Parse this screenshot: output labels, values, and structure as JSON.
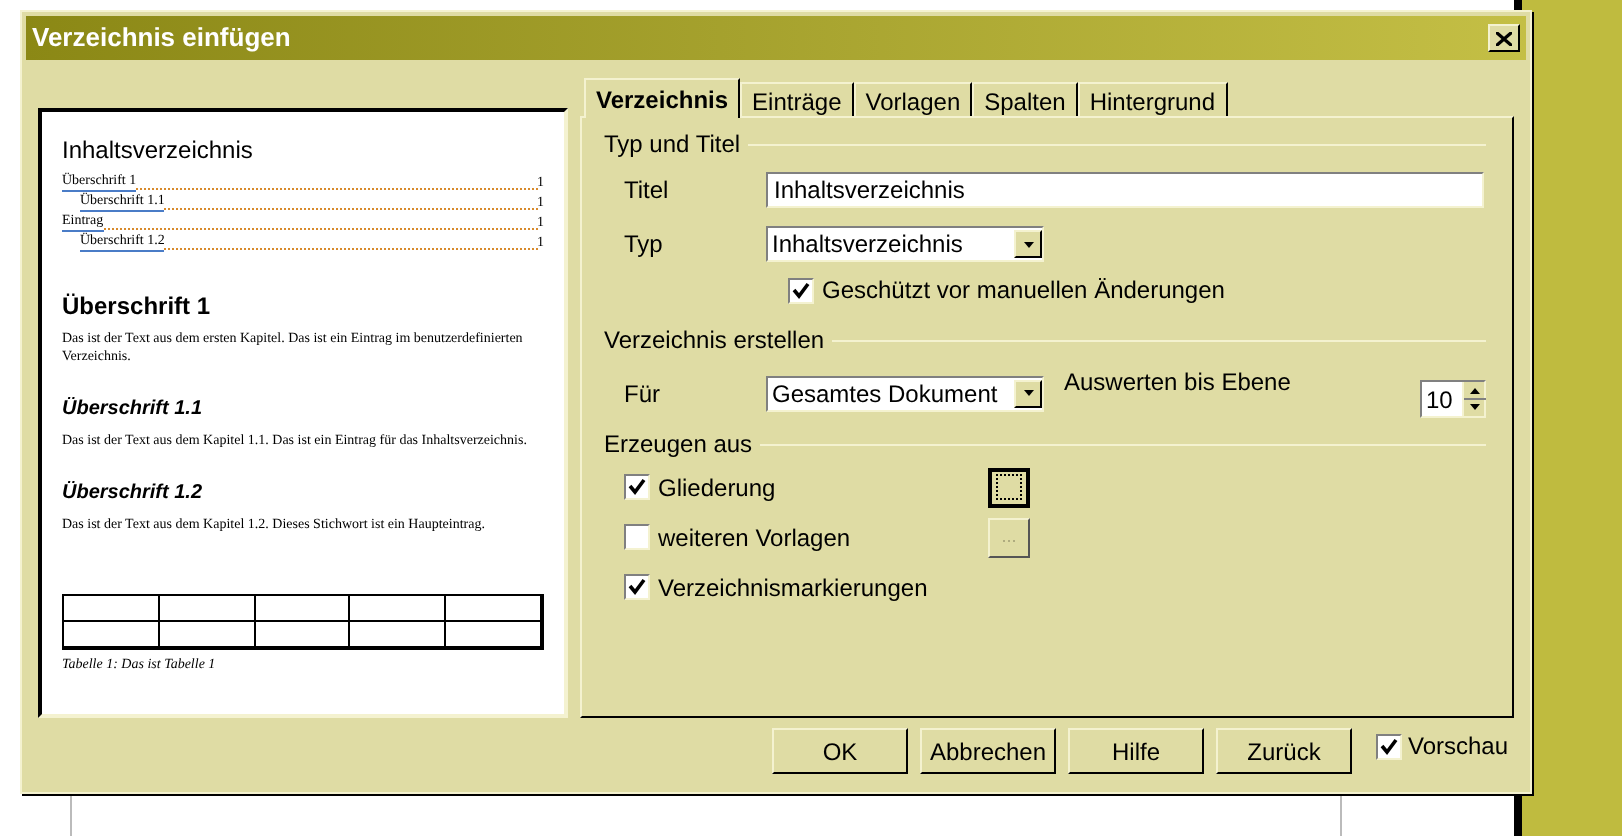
{
  "window": {
    "title": "Verzeichnis einfügen"
  },
  "preview": {
    "heading": "Inhaltsverzeichnis",
    "toc_entries": [
      {
        "text": "Überschrift 1",
        "page": "1",
        "children": [
          {
            "text": "Überschrift 1.1",
            "page": "1"
          }
        ]
      },
      {
        "text": "Eintrag",
        "page": "1",
        "children": [
          {
            "text": "Überschrift 1.2",
            "page": "1"
          }
        ]
      }
    ],
    "sections": [
      {
        "kind": "h1",
        "heading": "Überschrift 1",
        "body": "Das ist der Text aus dem ersten Kapitel. Das ist ein Eintrag im benutzerdefinierten Verzeichnis."
      },
      {
        "kind": "h2",
        "heading": "Überschrift 1.1",
        "body": "Das ist der Text aus dem Kapitel 1.1. Das ist ein Eintrag für das Inhaltsverzeichnis."
      },
      {
        "kind": "h2",
        "heading": "Überschrift 1.2",
        "body": "Das ist der Text aus dem Kapitel 1.2. Dieses Stichwort ist ein Haupteintrag."
      }
    ],
    "table_caption": "Tabelle 1: Das ist Tabelle 1"
  },
  "tabs": [
    {
      "label": "Verzeichnis",
      "selected": true
    },
    {
      "label": "Einträge",
      "selected": false
    },
    {
      "label": "Vorlagen",
      "selected": false
    },
    {
      "label": "Spalten",
      "selected": false
    },
    {
      "label": "Hintergrund",
      "selected": false
    }
  ],
  "type_and_title": {
    "heading": "Typ und Titel",
    "title_label": "Titel",
    "title_value": "Inhaltsverzeichnis",
    "type_label": "Typ",
    "type_value": "Inhaltsverzeichnis",
    "protected": {
      "label": "Geschützt vor manuellen Änderungen",
      "checked": true
    }
  },
  "create": {
    "heading": "Verzeichnis erstellen",
    "for_label": "Für",
    "for_value": "Gesamtes Dokument",
    "level_label": "Auswerten bis Ebene",
    "level_value": "10"
  },
  "generate": {
    "heading": "Erzeugen aus",
    "options": [
      {
        "label": "Gliederung",
        "checked": true,
        "button": {
          "focused": true,
          "disabled": false
        }
      },
      {
        "label": "weiteren Vorlagen",
        "checked": false,
        "button": {
          "label": "...",
          "focused": false,
          "disabled": true
        }
      },
      {
        "label": "Verzeichnismarkierungen",
        "checked": true
      }
    ]
  },
  "buttons": [
    {
      "label": "OK"
    },
    {
      "label": "Abbrechen"
    },
    {
      "label": "Hilfe"
    },
    {
      "label": "Zurück"
    }
  ],
  "preview_toggle": {
    "label": "Vorschau",
    "checked": true
  }
}
